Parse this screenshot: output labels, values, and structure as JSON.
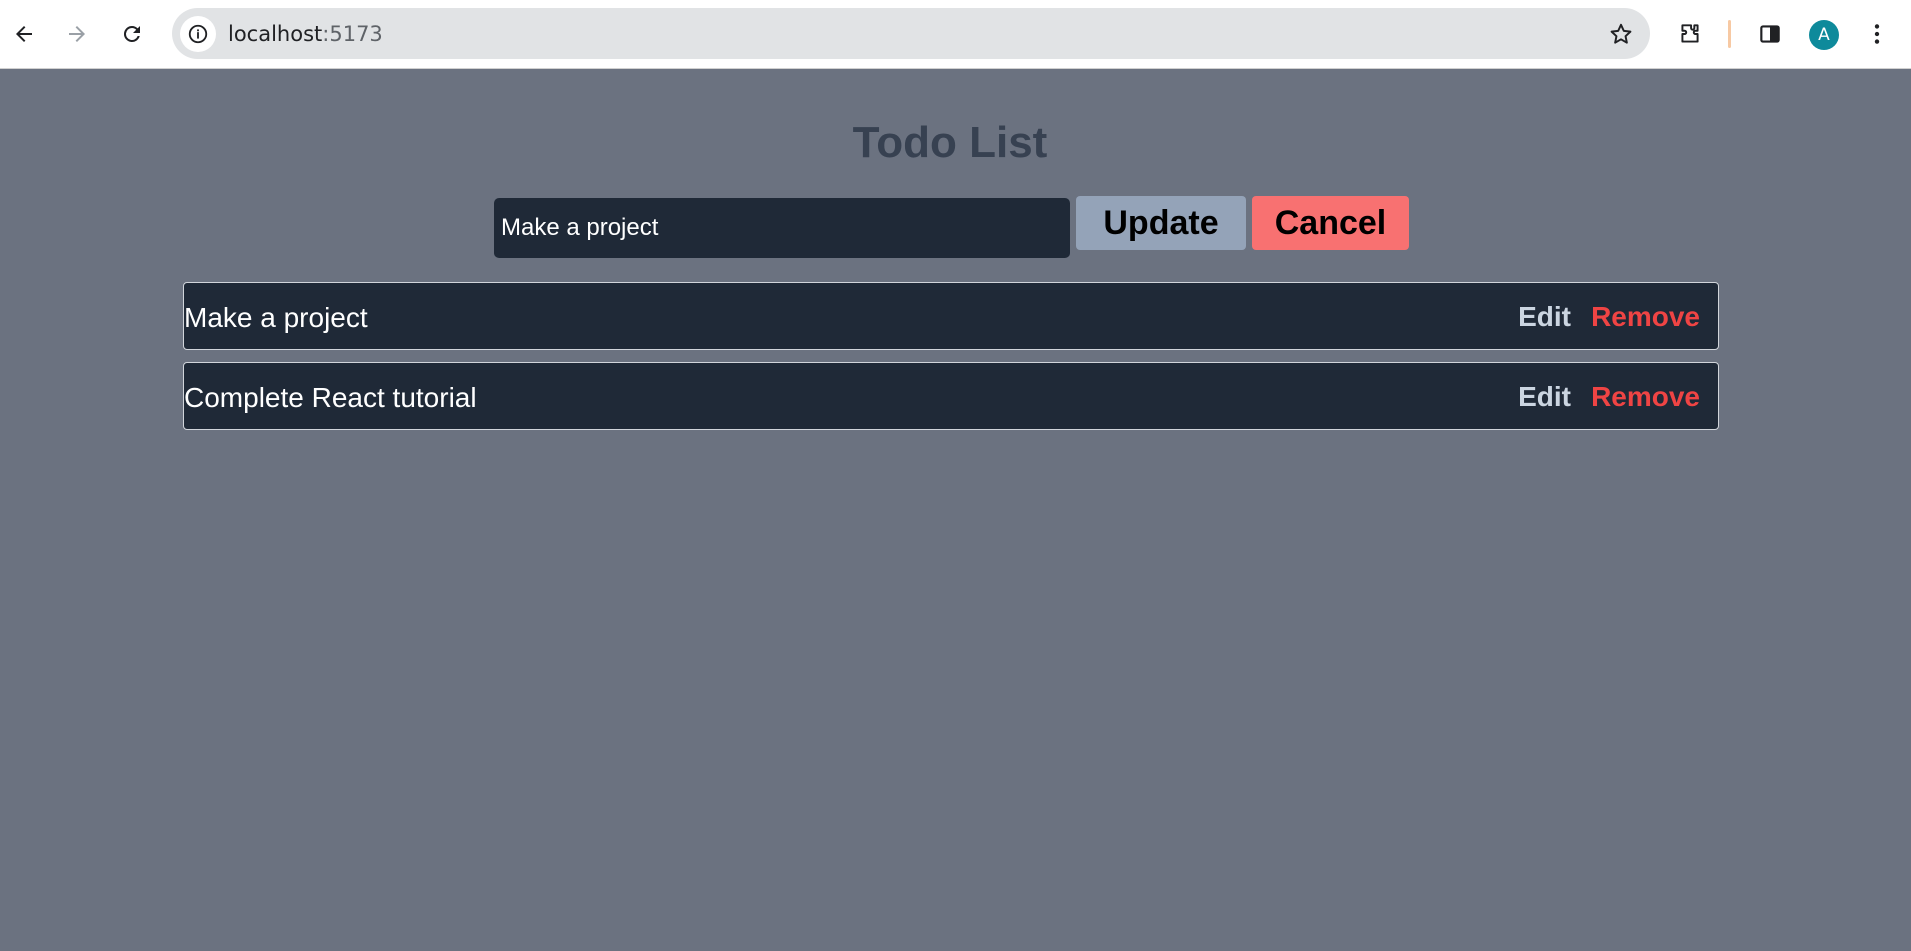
{
  "browser": {
    "url_host": "localhost",
    "url_port": ":5173",
    "avatar_initial": "A",
    "icons": [
      "back-arrow-icon",
      "forward-arrow-icon",
      "reload-icon",
      "info-icon",
      "star-icon",
      "extensions-icon",
      "side-panel-icon",
      "more-menu-icon"
    ]
  },
  "app": {
    "title": "Todo List",
    "input_value": "Make a project",
    "update_label": "Update",
    "cancel_label": "Cancel",
    "todos": [
      {
        "text": "Make a project",
        "edit_label": "Edit",
        "remove_label": "Remove"
      },
      {
        "text": "Complete React tutorial",
        "edit_label": "Edit",
        "remove_label": "Remove"
      }
    ]
  },
  "colors": {
    "page_bg": "#6b7280",
    "card_bg": "#1f2937",
    "update_bg": "#94a3b8",
    "cancel_bg": "#f87171",
    "remove_text": "#ef4444",
    "edit_text": "#cbd5e1"
  }
}
